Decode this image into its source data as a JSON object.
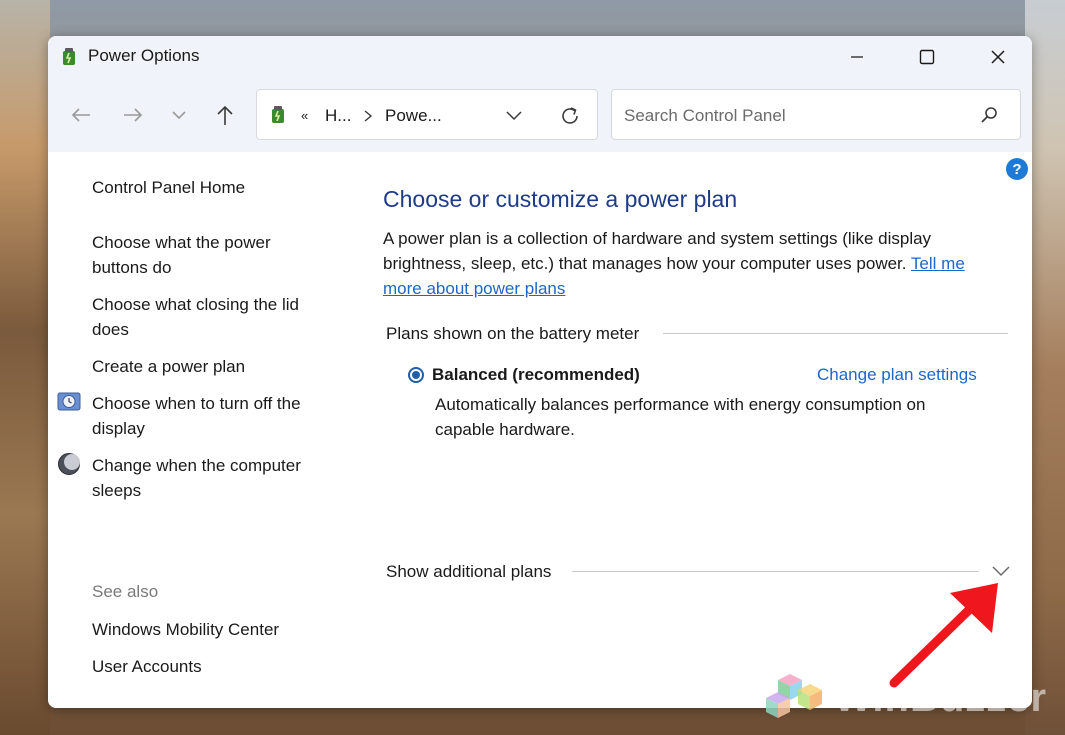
{
  "window": {
    "title": "Power Options"
  },
  "toolbar": {
    "crumb_overflow": "«",
    "crumb_1": "H...",
    "crumb_2": "Powe...",
    "search_placeholder": "Search Control Panel"
  },
  "sidebar": {
    "home": "Control Panel Home",
    "tasks": [
      "Choose what the power buttons do",
      "Choose what closing the lid does",
      "Create a power plan",
      "Choose when to turn off the display",
      "Change when the computer sleeps"
    ],
    "see_also_label": "See also",
    "see_also": [
      "Windows Mobility Center",
      "User Accounts"
    ]
  },
  "main": {
    "title": "Choose or customize a power plan",
    "description": "A power plan is a collection of hardware and system settings (like display brightness, sleep, etc.) that manages how your computer uses power.",
    "learn_link": "Tell me more about power plans",
    "plans_section": "Plans shown on the battery meter",
    "plan": {
      "name": "Balanced (recommended)",
      "change_link": "Change plan settings",
      "description": "Automatically balances performance with energy consumption on capable hardware.",
      "selected": true
    },
    "additional_plans": "Show additional plans"
  },
  "overlay": {
    "watermark_text": "WinBuzzer",
    "arrow_color": "#f0161d"
  }
}
